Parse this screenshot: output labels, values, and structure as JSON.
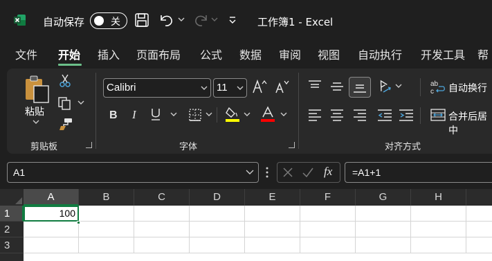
{
  "titlebar": {
    "autosave_label": "自动保存",
    "autosave_toggle_state": "关",
    "doc_title": "工作簿1  -  Excel"
  },
  "tabs": [
    {
      "label": "文件"
    },
    {
      "label": "开始"
    },
    {
      "label": "插入"
    },
    {
      "label": "页面布局"
    },
    {
      "label": "公式"
    },
    {
      "label": "数据"
    },
    {
      "label": "审阅"
    },
    {
      "label": "视图"
    },
    {
      "label": "自动执行"
    },
    {
      "label": "开发工具"
    },
    {
      "label": "帮"
    }
  ],
  "ribbon": {
    "clipboard": {
      "paste_label": "粘贴",
      "group_label": "剪贴板"
    },
    "font": {
      "font_name": "Calibri",
      "font_size": "11",
      "group_label": "字体",
      "highlight_color": "#ffff00",
      "font_color": "#ff0000"
    },
    "alignment": {
      "wrap_text_label": "自动换行",
      "merge_label": "合并后居中",
      "group_label": "对齐方式"
    }
  },
  "formula_bar": {
    "name_box": "A1",
    "fx_label": "fx",
    "formula": "=A1+1"
  },
  "grid": {
    "columns": [
      "A",
      "B",
      "C",
      "D",
      "E",
      "F",
      "G",
      "H"
    ],
    "rows": [
      "1",
      "2",
      "3"
    ],
    "active_cell_value": "100"
  },
  "colors": {
    "accent": "#107c41",
    "tab_underline": "#6cc08a"
  }
}
